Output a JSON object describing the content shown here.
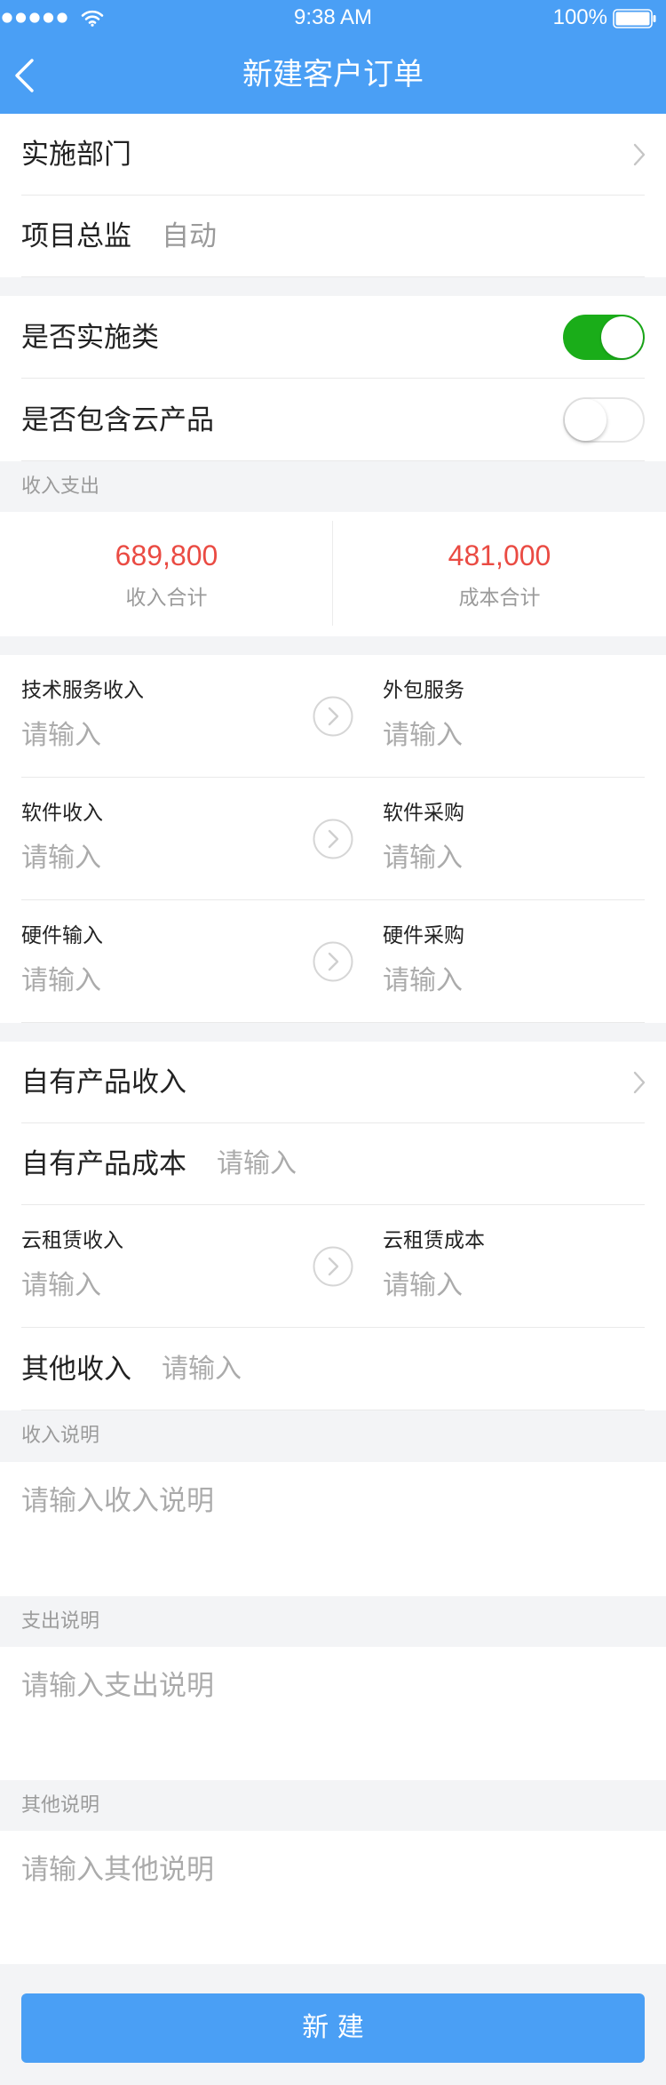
{
  "theme": {
    "primary": "#4a9ff5",
    "toggle_on": "#1aad19",
    "amount": "#ea4b43",
    "page_bg": "#f3f4f6"
  },
  "status_bar": {
    "time": "9:38 AM",
    "battery": "100%",
    "signal_strength": 5,
    "icons": {
      "signal": "signal-dots-icon",
      "wifi": "wifi-icon",
      "battery": "battery-icon"
    }
  },
  "nav": {
    "title": "新建客户订单",
    "back_icon": "chevron-left-icon"
  },
  "basic": {
    "department_label": "实施部门",
    "director_label": "项目总监",
    "director_value": "自动"
  },
  "switches": {
    "implementation": {
      "label": "是否实施类",
      "on": true
    },
    "cloud_product": {
      "label": "是否包含云产品",
      "on": false
    }
  },
  "income_expense": {
    "header": "收入支出",
    "income_total": {
      "amount": "689,800",
      "label": "收入合计"
    },
    "cost_total": {
      "amount": "481,000",
      "label": "成本合计"
    }
  },
  "pairs": [
    {
      "left": {
        "label": "技术服务收入",
        "placeholder": "请输入"
      },
      "right": {
        "label": "外包服务",
        "placeholder": "请输入"
      }
    },
    {
      "left": {
        "label": "软件收入",
        "placeholder": "请输入"
      },
      "right": {
        "label": "软件采购",
        "placeholder": "请输入"
      }
    },
    {
      "left": {
        "label": "硬件输入",
        "placeholder": "请输入"
      },
      "right": {
        "label": "硬件采购",
        "placeholder": "请输入"
      }
    }
  ],
  "products": {
    "own_income_label": "自有产品收入",
    "own_cost_label": "自有产品成本",
    "own_cost_placeholder": "请输入",
    "cloud_pair": {
      "left": {
        "label": "云租赁收入",
        "placeholder": "请输入"
      },
      "right": {
        "label": "云租赁成本",
        "placeholder": "请输入"
      }
    },
    "other_income_label": "其他收入",
    "other_income_placeholder": "请输入"
  },
  "notes": [
    {
      "header": "收入说明",
      "placeholder": "请输入收入说明"
    },
    {
      "header": "支出说明",
      "placeholder": "请输入支出说明"
    },
    {
      "header": "其他说明",
      "placeholder": "请输入其他说明"
    }
  ],
  "submit_label": "新 建"
}
